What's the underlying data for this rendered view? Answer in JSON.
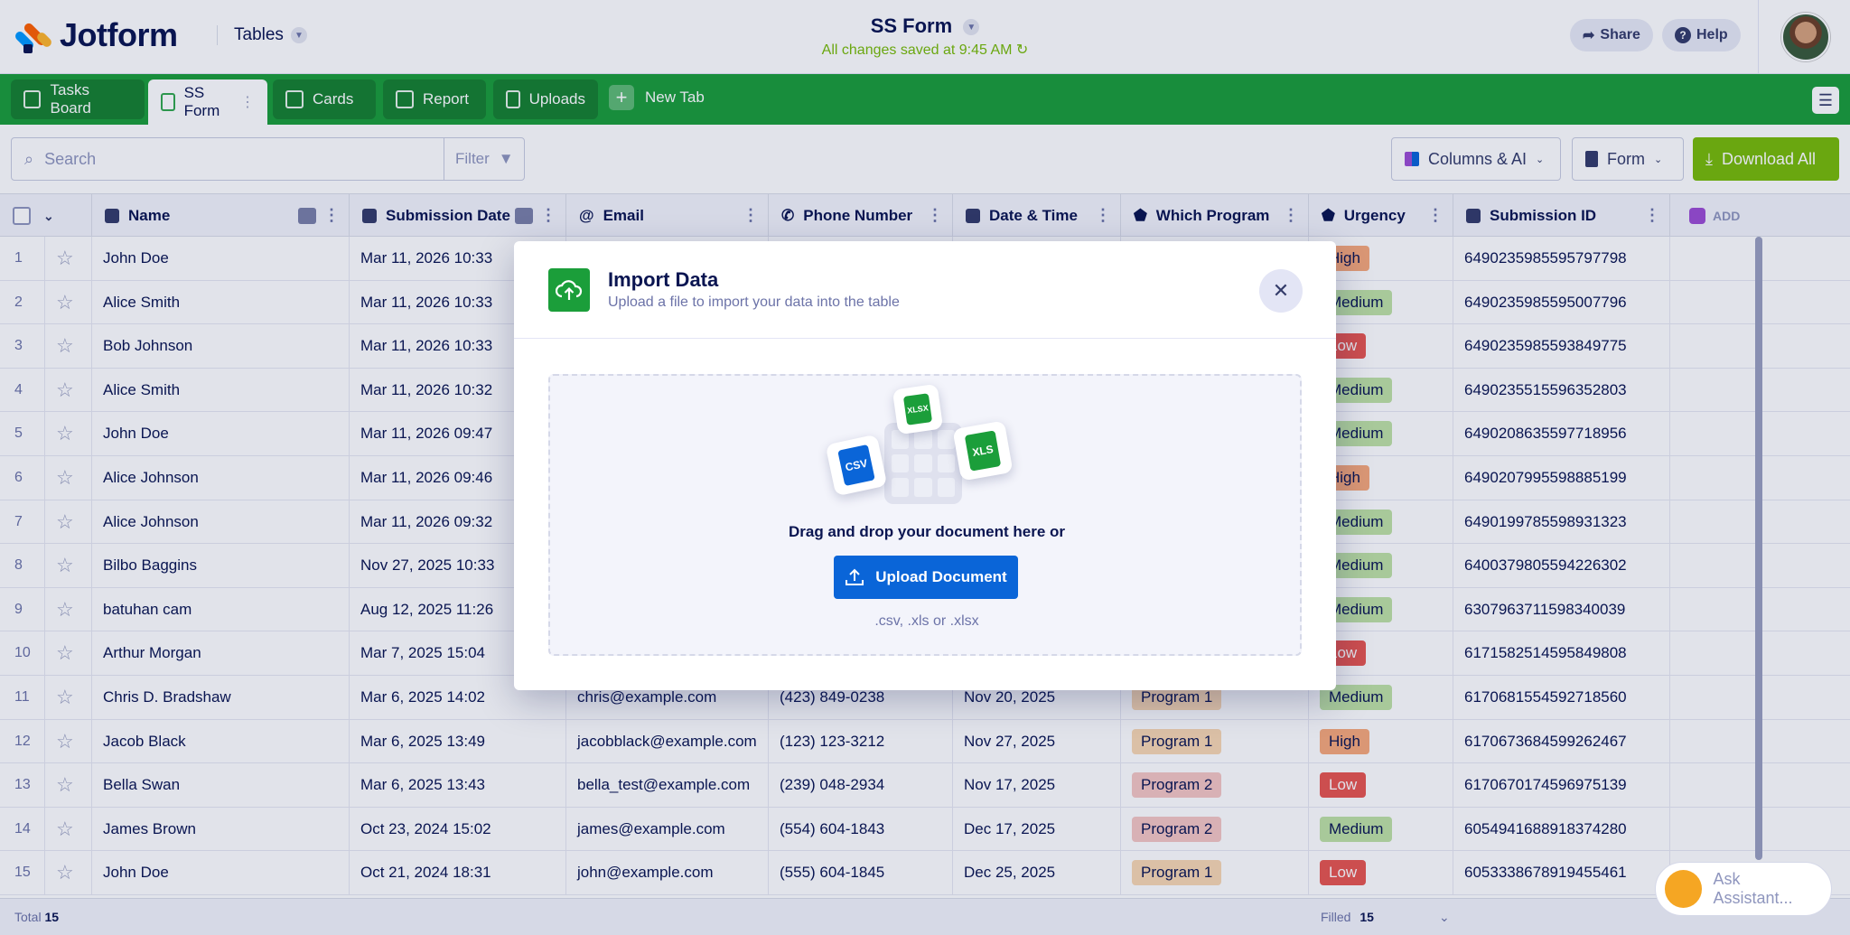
{
  "app": {
    "logo_text": "Jotform",
    "section": "Tables"
  },
  "header": {
    "form_title": "SS Form",
    "saved_status": "All changes saved at 9:45 AM",
    "share_label": "Share",
    "help_label": "Help"
  },
  "tabs": [
    {
      "label": "Tasks Board"
    },
    {
      "label": "SS Form"
    },
    {
      "label": "Cards"
    },
    {
      "label": "Report"
    },
    {
      "label": "Uploads"
    }
  ],
  "new_tab_label": "New Tab",
  "toolbar": {
    "search_placeholder": "Search",
    "filter_label": "Filter",
    "columns_label": "Columns & AI",
    "form_label": "Form",
    "download_label": "Download All"
  },
  "columns": [
    "Name",
    "Submission Date",
    "Email",
    "Phone Number",
    "Date & Time",
    "Which Program",
    "Urgency",
    "Submission ID"
  ],
  "add_column_label": "ADD",
  "rows": [
    {
      "n": "1",
      "name": "John Doe",
      "date": "Mar 11, 2026 10:33",
      "email": "",
      "phone": "",
      "dt": "",
      "program": "",
      "urgency": "High",
      "id": "6490235985595797798"
    },
    {
      "n": "2",
      "name": "Alice Smith",
      "date": "Mar 11, 2026 10:33",
      "email": "",
      "phone": "",
      "dt": "",
      "program": "",
      "urgency": "Medium",
      "id": "6490235985595007796"
    },
    {
      "n": "3",
      "name": "Bob Johnson",
      "date": "Mar 11, 2026 10:33",
      "email": "",
      "phone": "",
      "dt": "",
      "program": "",
      "urgency": "Low",
      "id": "6490235985593849775"
    },
    {
      "n": "4",
      "name": "Alice Smith",
      "date": "Mar 11, 2026 10:32",
      "email": "",
      "phone": "",
      "dt": "",
      "program": "",
      "urgency": "Medium",
      "id": "6490235515596352803"
    },
    {
      "n": "5",
      "name": "John Doe",
      "date": "Mar 11, 2026 09:47",
      "email": "",
      "phone": "",
      "dt": "",
      "program": "",
      "urgency": "Medium",
      "id": "6490208635597718956"
    },
    {
      "n": "6",
      "name": "Alice Johnson",
      "date": "Mar 11, 2026 09:46",
      "email": "",
      "phone": "",
      "dt": "",
      "program": "",
      "urgency": "High",
      "id": "6490207995598885199"
    },
    {
      "n": "7",
      "name": "Alice Johnson",
      "date": "Mar 11, 2026 09:32",
      "email": "",
      "phone": "",
      "dt": "",
      "program": "",
      "urgency": "Medium",
      "id": "6490199785598931323"
    },
    {
      "n": "8",
      "name": "Bilbo Baggins",
      "date": "Nov 27, 2025 10:33",
      "email": "",
      "phone": "",
      "dt": "",
      "program": "",
      "urgency": "Medium",
      "id": "6400379805594226302"
    },
    {
      "n": "9",
      "name": "batuhan cam",
      "date": "Aug 12, 2025 11:26",
      "email": "",
      "phone": "",
      "dt": "",
      "program": "",
      "urgency": "Medium",
      "id": "6307963711598340039"
    },
    {
      "n": "10",
      "name": "Arthur Morgan",
      "date": "Mar 7, 2025 15:04",
      "email": "",
      "phone": "",
      "dt": "",
      "program": "",
      "urgency": "Low",
      "id": "6171582514595849808"
    },
    {
      "n": "11",
      "name": "Chris D. Bradshaw",
      "date": "Mar 6, 2025 14:02",
      "email": "chris@example.com",
      "phone": "(423) 849-0238",
      "dt": "Nov 20, 2025",
      "program": "Program 1",
      "urgency": "Medium",
      "id": "6170681554592718560"
    },
    {
      "n": "12",
      "name": "Jacob Black",
      "date": "Mar 6, 2025 13:49",
      "email": "jacobblack@example.com",
      "phone": "(123) 123-3212",
      "dt": "Nov 27, 2025",
      "program": "Program 1",
      "urgency": "High",
      "id": "6170673684599262467"
    },
    {
      "n": "13",
      "name": "Bella Swan",
      "date": "Mar 6, 2025 13:43",
      "email": "bella_test@example.com",
      "phone": "(239) 048-2934",
      "dt": "Nov 17, 2025",
      "program": "Program 2",
      "urgency": "Low",
      "id": "6170670174596975139"
    },
    {
      "n": "14",
      "name": "James Brown",
      "date": "Oct 23, 2024 15:02",
      "email": "james@example.com",
      "phone": "(554) 604-1843",
      "dt": "Dec 17, 2025",
      "program": "Program 2",
      "urgency": "Medium",
      "id": "6054941688918374280"
    },
    {
      "n": "15",
      "name": "John Doe",
      "date": "Oct 21, 2024 18:31",
      "email": "john@example.com",
      "phone": "(555) 604-1845",
      "dt": "Dec 25, 2025",
      "program": "Program 1",
      "urgency": "Low",
      "id": "6053338678919455461"
    }
  ],
  "footer": {
    "total_label": "Total",
    "total_value": "15",
    "filled_label": "Filled",
    "filled_value": "15"
  },
  "assistant_label": "Ask Assistant...",
  "modal": {
    "title": "Import Data",
    "subtitle": "Upload a file to import your data into the table",
    "drag_text": "Drag and drop your document here or",
    "upload_label": "Upload Document",
    "extensions": ".csv, .xls or .xlsx",
    "file_badges": {
      "csv": "CSV",
      "xlsx": "XLSX",
      "xls": "XLS"
    }
  },
  "colors": {
    "brand_green": "#1b9e3a",
    "download_green": "#78bb07",
    "upload_blue": "#0a65d8",
    "navy": "#0a1551"
  }
}
